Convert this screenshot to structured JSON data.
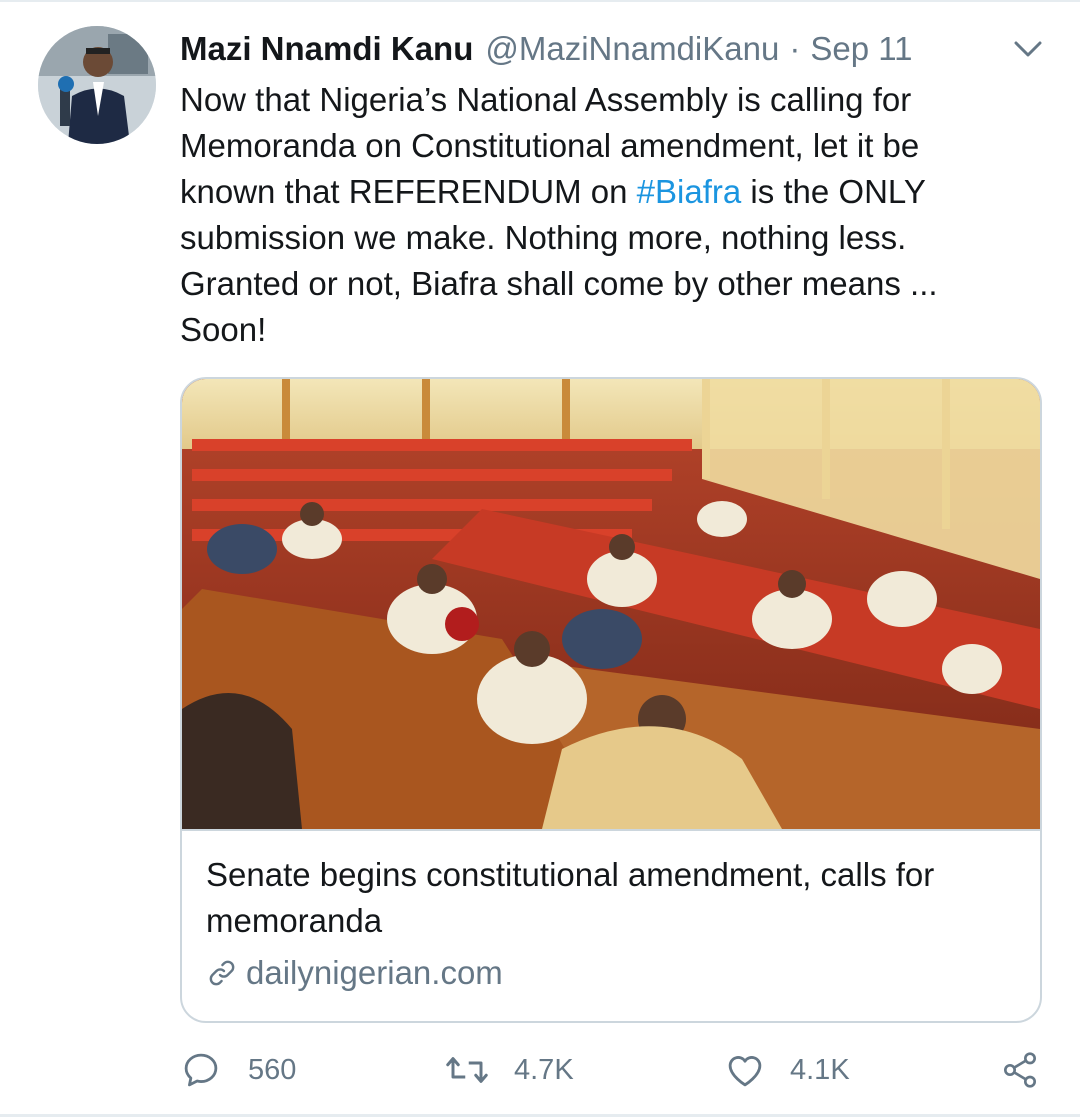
{
  "tweet": {
    "display_name": "Mazi Nnamdi Kanu",
    "handle": "@MaziNnamdiKanu",
    "separator": "·",
    "date": "Sep 11",
    "text_lines": [
      [
        "Now that Nigeria’s National Assembly is calling for"
      ],
      [
        "Memoranda on Constitutional amendment, let it be"
      ],
      [
        "known that REFERENDUM on ",
        "#Biafra",
        " is the ONLY"
      ],
      [
        "submission we make. Nothing more, nothing less."
      ],
      [
        "Granted or not, Biafra shall come by other means ..."
      ],
      [
        "Soon!"
      ]
    ]
  },
  "card": {
    "title": "Senate begins constitutional amendment, calls for memoranda",
    "domain": "dailynigerian.com"
  },
  "actions": {
    "replies": "560",
    "retweets": "4.7K",
    "likes": "4.1K"
  },
  "colors": {
    "text": "#14171a",
    "secondary": "#657786",
    "link": "#1b95e0",
    "border": "#ccd6dd"
  },
  "icons": [
    "chevron-down-icon",
    "link-icon",
    "reply-icon",
    "retweet-icon",
    "like-icon",
    "share-icon"
  ]
}
